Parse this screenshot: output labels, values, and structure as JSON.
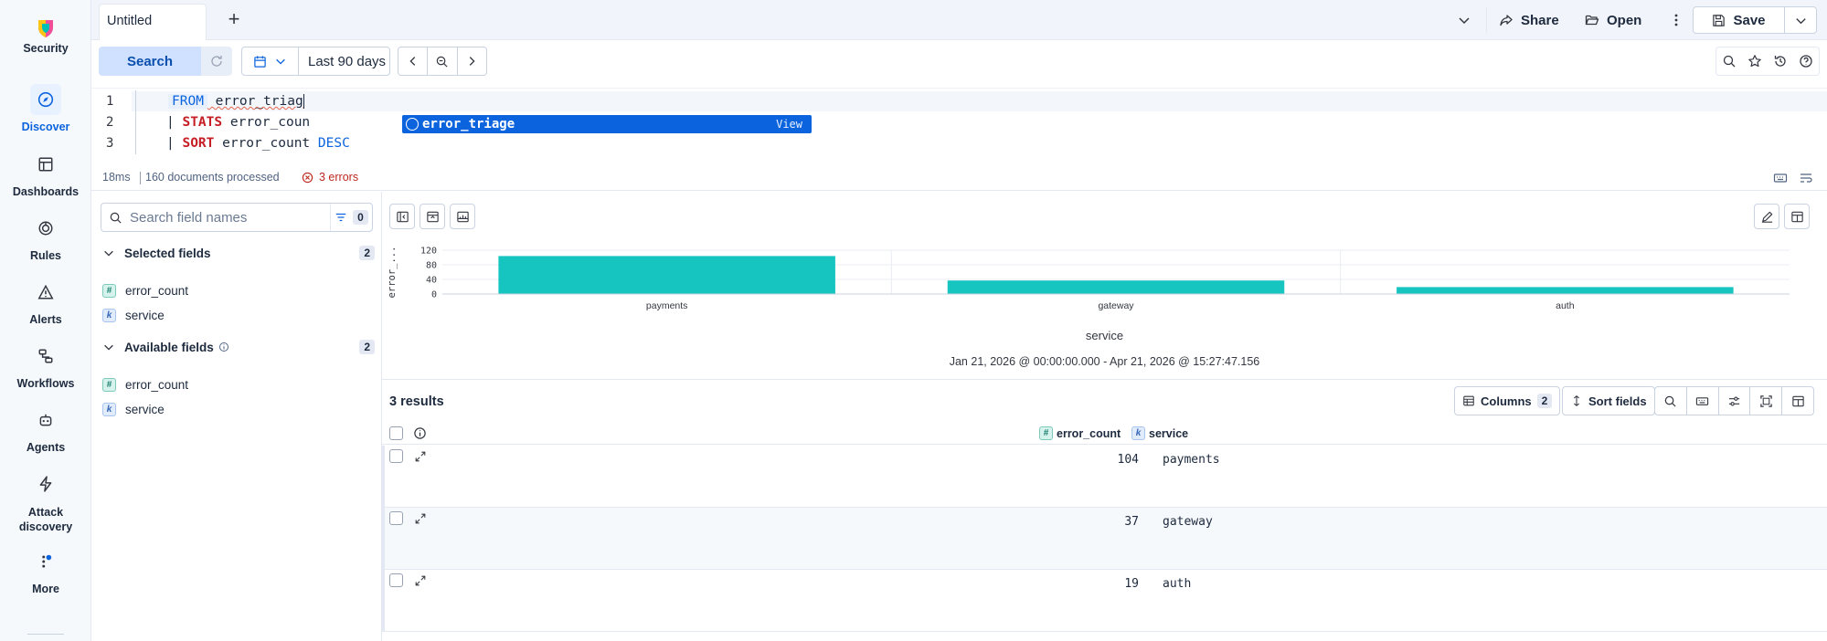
{
  "nav": {
    "items": [
      {
        "label": "Security",
        "icon": "security-logo"
      },
      {
        "label": "Discover",
        "icon": "discover-icon"
      },
      {
        "label": "Dashboards",
        "icon": "dashboards-icon"
      },
      {
        "label": "Rules",
        "icon": "rules-icon"
      },
      {
        "label": "Alerts",
        "icon": "alerts-icon"
      },
      {
        "label": "Workflows",
        "icon": "workflows-icon"
      },
      {
        "label": "Agents",
        "icon": "agents-icon"
      },
      {
        "label": "Attack discovery",
        "icon": "attack-discovery-icon"
      },
      {
        "label": "More",
        "icon": "more-icon"
      }
    ]
  },
  "tabs": {
    "active": "Untitled"
  },
  "topbar": {
    "share": "Share",
    "open": "Open",
    "save": "Save"
  },
  "query": {
    "search_label": "Search",
    "date_range": "Last 90 days",
    "lines": [
      {
        "num": "1",
        "kw": "FROM",
        "rest": " error_triag"
      },
      {
        "num": "2",
        "kw": "STATS",
        "rest": " error_coun",
        "pre": "| "
      },
      {
        "num": "3",
        "kw": "SORT",
        "rest": " error_count ",
        "post": "DESC",
        "pre": "| "
      }
    ],
    "suggestion": {
      "name": "error_triage",
      "action": "View"
    }
  },
  "status": {
    "time": "18ms",
    "docs": "160 documents processed",
    "errors": "3 errors"
  },
  "sidebar": {
    "search_placeholder": "Search field names",
    "filter_count": "0",
    "selected": {
      "title": "Selected fields",
      "count": "2",
      "fields": [
        {
          "type": "#",
          "name": "error_count"
        },
        {
          "type": "k",
          "name": "service"
        }
      ]
    },
    "available": {
      "title": "Available fields",
      "count": "2",
      "fields": [
        {
          "type": "#",
          "name": "error_count"
        },
        {
          "type": "k",
          "name": "service"
        }
      ]
    }
  },
  "chart_data": {
    "type": "bar",
    "categories": [
      "payments",
      "gateway",
      "auth"
    ],
    "values": [
      104,
      37,
      19
    ],
    "xlabel": "service",
    "ylabel": "error_...",
    "yticks": [
      0,
      40,
      80,
      120
    ],
    "ylim": [
      0,
      120
    ],
    "color": "#16c5c0"
  },
  "timerange": "Jan 21, 2026 @ 00:00:00.000 - Apr 21, 2026 @ 15:27:47.156",
  "results": {
    "title": "3 results",
    "columns_label": "Columns",
    "columns_count": "2",
    "sort_label": "Sort fields",
    "headers": [
      {
        "type": "#",
        "name": "error_count"
      },
      {
        "type": "k",
        "name": "service"
      }
    ],
    "rows": [
      {
        "error_count": "104",
        "service": "payments"
      },
      {
        "error_count": "37",
        "service": "gateway"
      },
      {
        "error_count": "19",
        "service": "auth"
      }
    ]
  }
}
